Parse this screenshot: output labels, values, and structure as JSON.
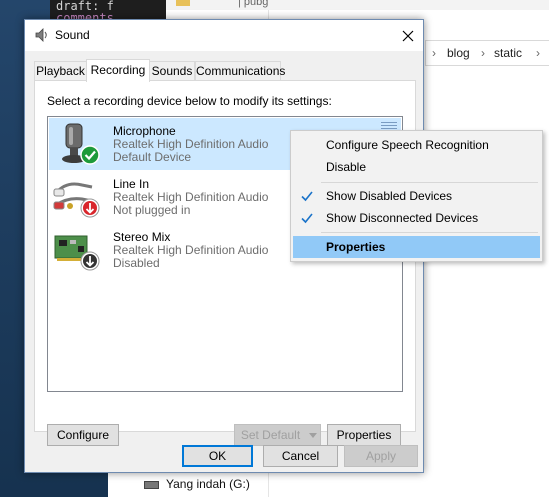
{
  "background": {
    "editor_lines": [
      "draft: f",
      "comments"
    ],
    "toolbar_label": "| pubg",
    "address_parts": [
      "blog",
      "static"
    ],
    "drive_label": "Yang indah (G:)"
  },
  "dialog": {
    "title": "Sound",
    "tabs": [
      {
        "label": "Playback"
      },
      {
        "label": "Recording"
      },
      {
        "label": "Sounds"
      },
      {
        "label": "Communications"
      }
    ],
    "active_tab": "Recording",
    "instruction": "Select a recording device below to modify its settings:",
    "devices": [
      {
        "name": "Microphone",
        "driver": "Realtek High Definition Audio",
        "status": "Default Device",
        "badge": "default-check-icon",
        "selected": true
      },
      {
        "name": "Line In",
        "driver": "Realtek High Definition Audio",
        "status": "Not plugged in",
        "badge": "unplugged-arrow-icon",
        "selected": false
      },
      {
        "name": "Stereo Mix",
        "driver": "Realtek High Definition Audio",
        "status": "Disabled",
        "badge": "disabled-arrow-icon",
        "selected": false
      }
    ],
    "buttons": {
      "configure": "Configure",
      "set_default": "Set Default",
      "properties": "Properties",
      "ok": "OK",
      "cancel": "Cancel",
      "apply": "Apply"
    }
  },
  "context_menu": {
    "items": [
      {
        "label": "Configure Speech Recognition",
        "checked": false
      },
      {
        "label": "Disable",
        "checked": false
      },
      {
        "label": "Show Disabled Devices",
        "checked": true
      },
      {
        "label": "Show Disconnected Devices",
        "checked": true
      },
      {
        "label": "Properties",
        "checked": false,
        "highlighted": true,
        "bold": true
      }
    ]
  },
  "colors": {
    "selection": "#cce8ff",
    "menu_highlight": "#91c9f7",
    "accent": "#0078d7",
    "default_badge": "#1e9a3a",
    "unplugged_badge": "#d9262c"
  }
}
